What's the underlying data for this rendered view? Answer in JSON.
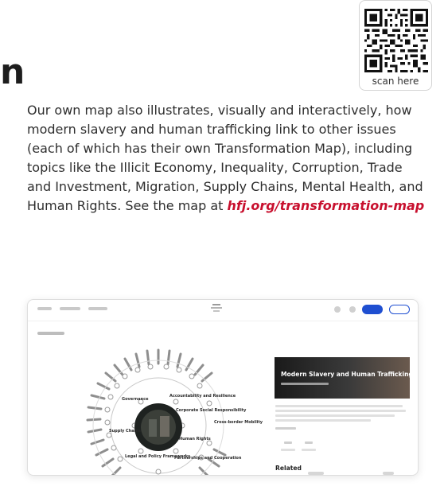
{
  "header": {
    "title_fragment": "n"
  },
  "qr": {
    "caption": "scan here"
  },
  "intro": {
    "text": "Our own map also illustrates, visually and interactively, how modern slavery and human trafficking link to other issues (each of which has their own Transformation Map), including topics like the Illicit Economy, Inequality, Corruption, Trade and Investment, Migration, Supply Chains, Mental Health, and Human Rights. See the map at ",
    "link": "hfj.org/transformation-map"
  },
  "screenshot": {
    "panel_title": "Modern Slavery and Human Trafficking",
    "panel_heading": "Related",
    "map_nodes": [
      "Governance",
      "Accountability and Resilience",
      "Corporate Social Responsibility",
      "Legal and Policy Frameworks",
      "Partnerships and Cooperation",
      "Cross-border Mobility",
      "Supply Chains",
      "Human Rights"
    ]
  },
  "colors": {
    "link": "#c8102e",
    "primary_button": "#1f4fd1",
    "text": "#2e2e2e"
  }
}
